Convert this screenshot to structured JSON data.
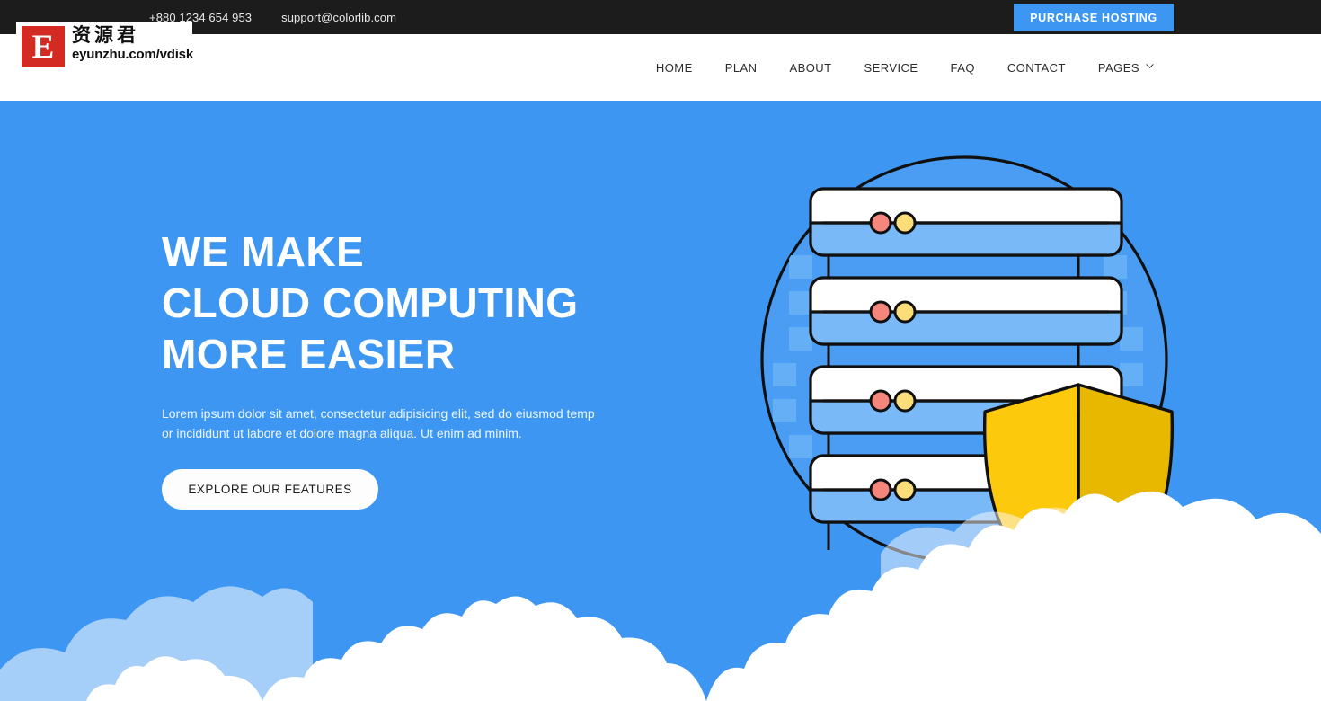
{
  "topbar": {
    "phone": "+880 1234 654 953",
    "email": "support@colorlib.com",
    "purchase_label": "PURCHASE HOSTING",
    "background": "#1c1c1c",
    "button_color": "#3d97f2"
  },
  "nav": {
    "items": [
      {
        "label": "HOME"
      },
      {
        "label": "PLAN"
      },
      {
        "label": "ABOUT"
      },
      {
        "label": "SERVICE"
      },
      {
        "label": "FAQ"
      },
      {
        "label": "CONTACT"
      },
      {
        "label": "PAGES",
        "has_dropdown": true
      }
    ]
  },
  "hero": {
    "title_line1": "WE MAKE",
    "title_line2": "CLOUD COMPUTING",
    "title_line3": "MORE EASIER",
    "sub_line1": "Lorem ipsum dolor sit amet, consectetur adipisicing elit, sed do eiusmod temp",
    "sub_line2": "or incididunt ut labore et dolore magna aliqua. Ut enim ad minim.",
    "cta_label": "EXPLORE OUR FEATURES",
    "background": "#3d97f2",
    "shield_color": "#fcc90a",
    "shield_shade": "#e6b600"
  },
  "watermark": {
    "letter": "E",
    "chinese": "资源君",
    "url": "eyunzhu.com/vdisk",
    "box_color": "#d32a22"
  }
}
